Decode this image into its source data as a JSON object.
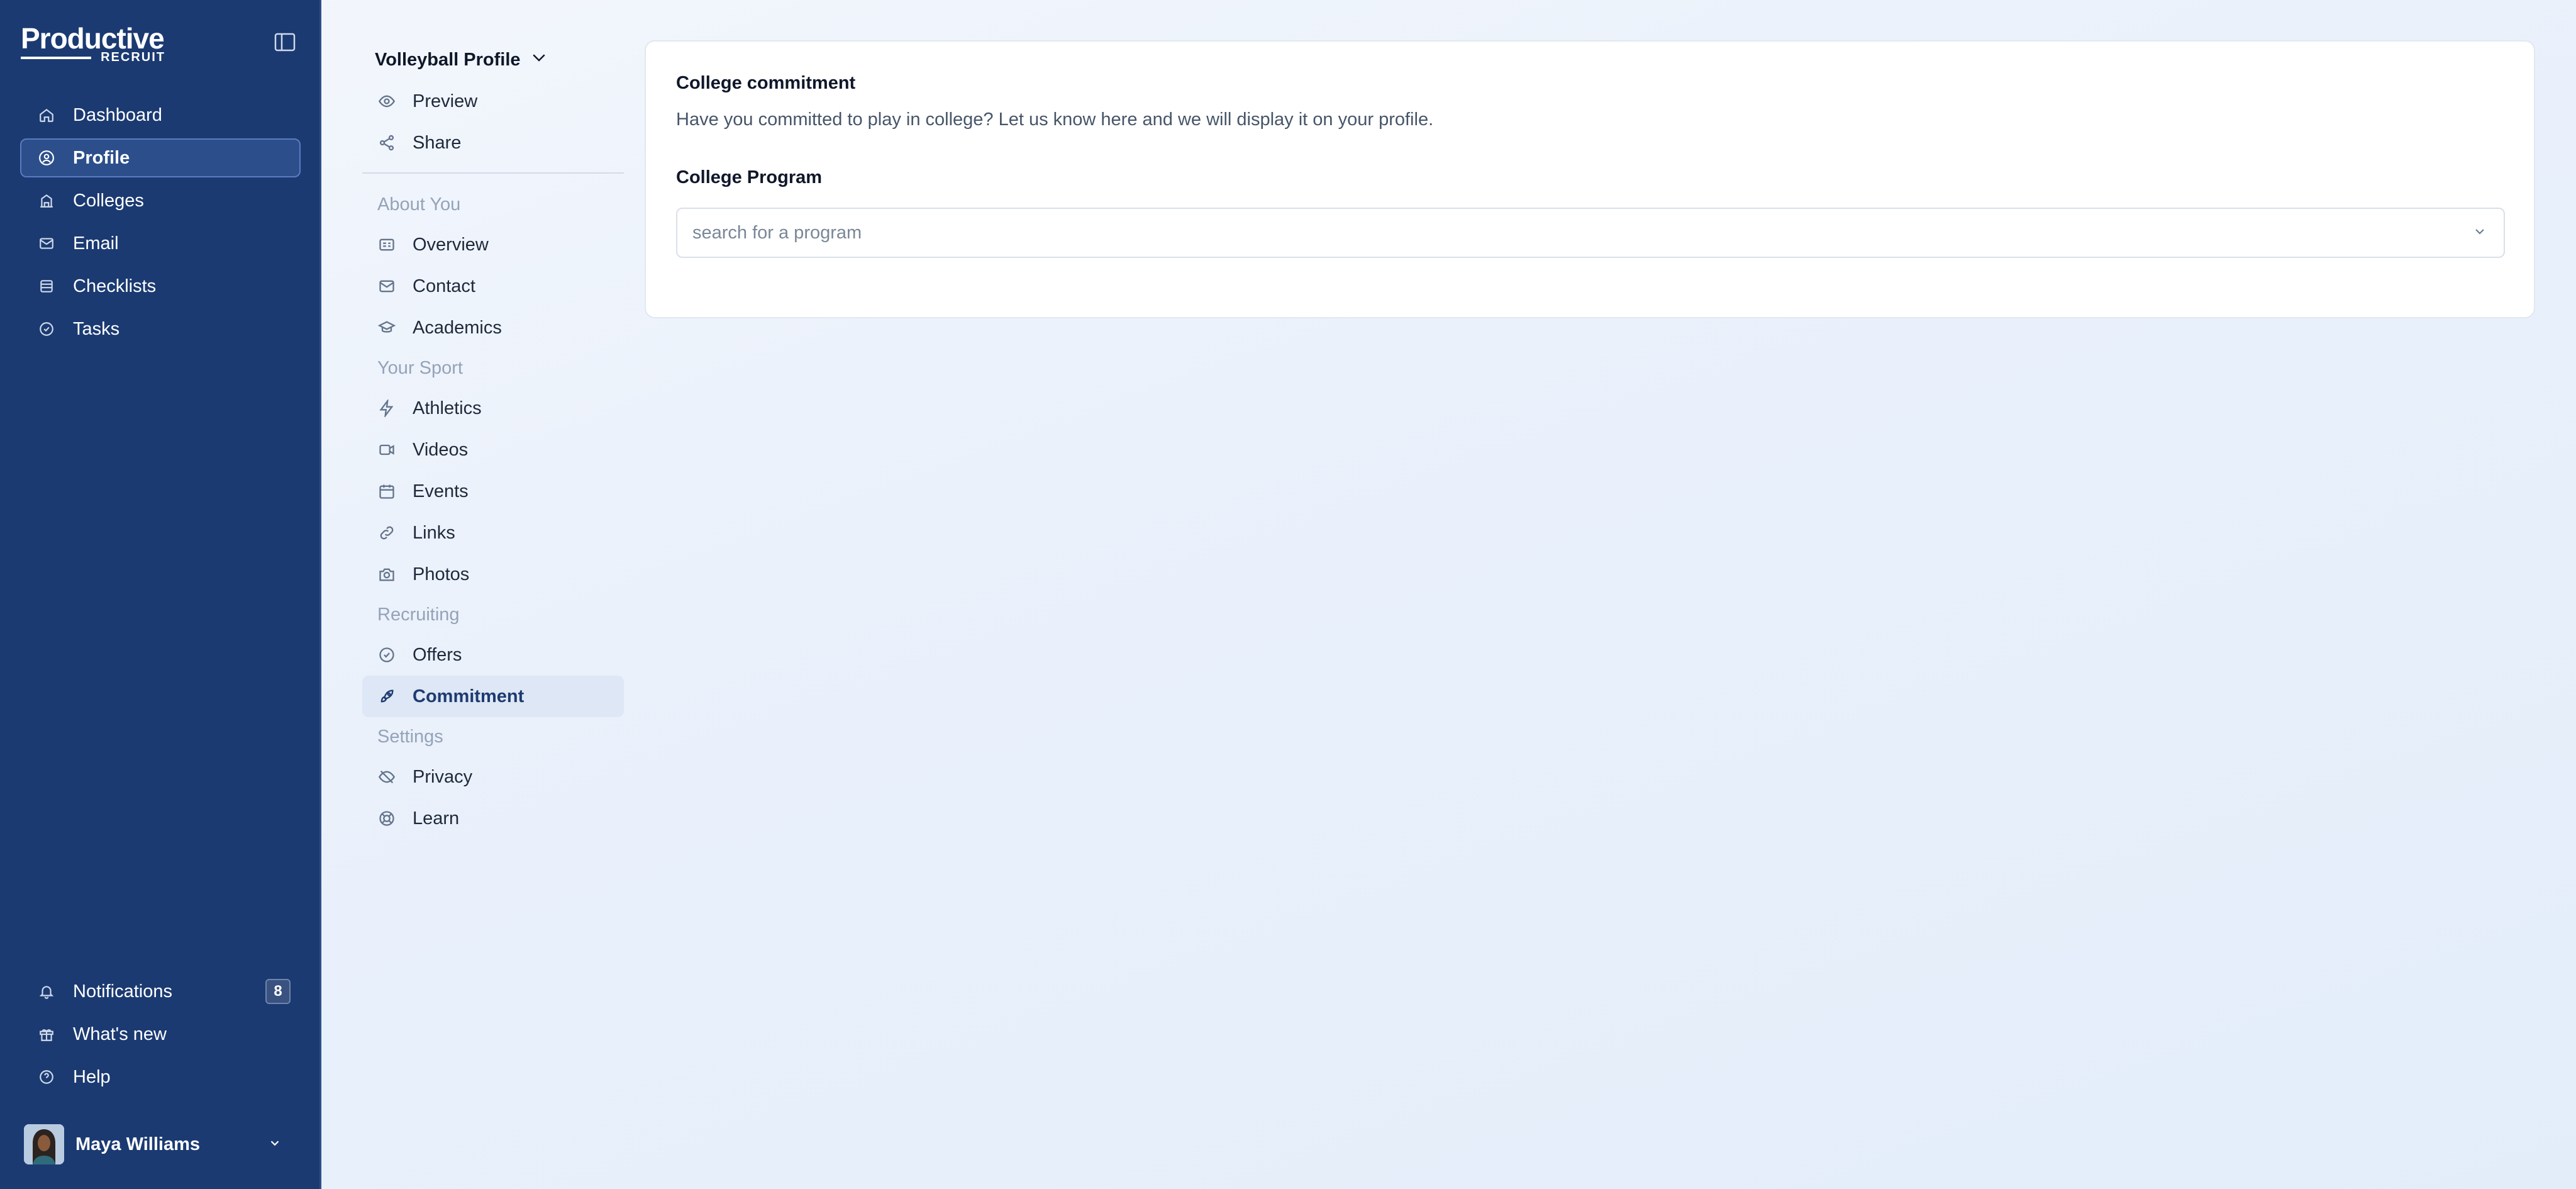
{
  "brand": {
    "name": "Productive",
    "sub": "RECRUIT"
  },
  "sidebar": {
    "items": [
      {
        "label": "Dashboard",
        "icon": "home-icon"
      },
      {
        "label": "Profile",
        "icon": "user-circle-icon",
        "active": true
      },
      {
        "label": "Colleges",
        "icon": "building-icon"
      },
      {
        "label": "Email",
        "icon": "mail-icon"
      },
      {
        "label": "Checklists",
        "icon": "list-icon"
      },
      {
        "label": "Tasks",
        "icon": "check-circle-icon"
      }
    ],
    "bottom": [
      {
        "label": "Notifications",
        "icon": "bell-icon",
        "badge": "8"
      },
      {
        "label": "What's new",
        "icon": "gift-icon"
      },
      {
        "label": "Help",
        "icon": "help-circle-icon"
      }
    ],
    "user": {
      "name": "Maya Williams"
    }
  },
  "profile_menu": {
    "title": "Volleyball Profile",
    "top_items": [
      {
        "label": "Preview",
        "icon": "eye-icon"
      },
      {
        "label": "Share",
        "icon": "share-icon"
      }
    ],
    "sections": [
      {
        "title": "About You",
        "items": [
          {
            "label": "Overview",
            "icon": "id-card-icon"
          },
          {
            "label": "Contact",
            "icon": "mail-icon"
          },
          {
            "label": "Academics",
            "icon": "graduation-cap-icon"
          }
        ]
      },
      {
        "title": "Your Sport",
        "items": [
          {
            "label": "Athletics",
            "icon": "bolt-icon"
          },
          {
            "label": "Videos",
            "icon": "video-icon"
          },
          {
            "label": "Events",
            "icon": "calendar-icon"
          },
          {
            "label": "Links",
            "icon": "link-icon"
          },
          {
            "label": "Photos",
            "icon": "camera-icon"
          }
        ]
      },
      {
        "title": "Recruiting",
        "items": [
          {
            "label": "Offers",
            "icon": "check-circle-icon"
          },
          {
            "label": "Commitment",
            "icon": "rocket-icon",
            "active": true
          }
        ]
      },
      {
        "title": "Settings",
        "items": [
          {
            "label": "Privacy",
            "icon": "eye-off-icon"
          },
          {
            "label": "Learn",
            "icon": "lifebuoy-icon"
          }
        ]
      }
    ]
  },
  "main": {
    "title": "College commitment",
    "description": "Have you committed to play in college? Let us know here and we will display it on your profile.",
    "field_label": "College Program",
    "field_placeholder": "search for a program",
    "field_value": ""
  },
  "colors": {
    "sidebar_bg": "#1b3a72",
    "active_item_bg": "#2c4f8c",
    "submenu_active_bg": "#dde7f5",
    "page_bg": "#eaf1fb"
  }
}
